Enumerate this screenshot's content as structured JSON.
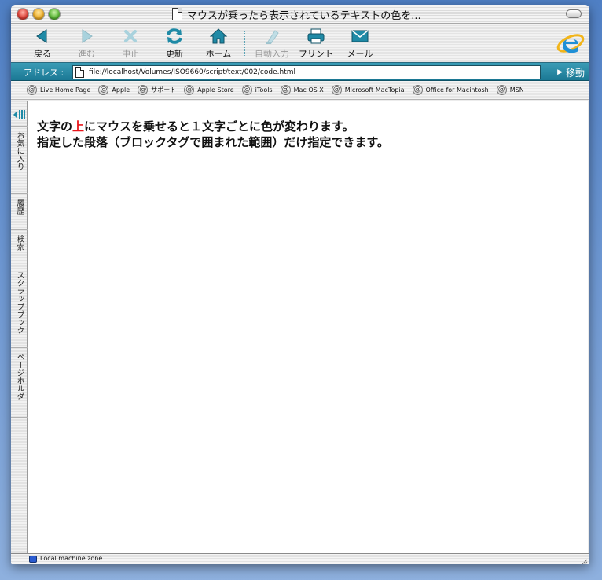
{
  "window": {
    "title": "マウスが乗ったら表示されているテキストの色を..."
  },
  "toolbar": {
    "buttons": [
      {
        "label": "戻る",
        "icon": "back-arrow-icon",
        "enabled": true
      },
      {
        "label": "進む",
        "icon": "forward-arrow-icon",
        "enabled": false
      },
      {
        "label": "中止",
        "icon": "stop-x-icon",
        "enabled": false
      },
      {
        "label": "更新",
        "icon": "refresh-icon",
        "enabled": true
      },
      {
        "label": "ホーム",
        "icon": "home-icon",
        "enabled": true
      },
      {
        "label": "自動入力",
        "icon": "autofill-icon",
        "enabled": false
      },
      {
        "label": "プリント",
        "icon": "print-icon",
        "enabled": true
      },
      {
        "label": "メール",
        "icon": "mail-icon",
        "enabled": true
      }
    ]
  },
  "address": {
    "label": "アドレス :",
    "value": "file://localhost/Volumes/ISO9660/script/text/002/code.html",
    "go_label": "移動"
  },
  "favorites": [
    "Live Home Page",
    "Apple",
    "サポート",
    "Apple Store",
    "iTools",
    "Mac OS X",
    "Microsoft MacTopia",
    "Office for Macintosh",
    "MSN"
  ],
  "sidebar_tabs": [
    "お気に入り",
    "履歴",
    "検索",
    "スクラップブック",
    "ページホルダ"
  ],
  "content": {
    "line1_before": "文字の",
    "line1_highlight": "上",
    "line1_after": "にマウスを乗せると１文字ごとに色が変わります。",
    "line2": "指定した段落（ブロックタグで囲まれた範囲）だけ指定できます。",
    "highlight_color": "#e8141a"
  },
  "status": {
    "zone": "Local machine zone"
  },
  "colors": {
    "accent_teal": "#1b7894",
    "icon_teal": "#1f8aa6"
  }
}
